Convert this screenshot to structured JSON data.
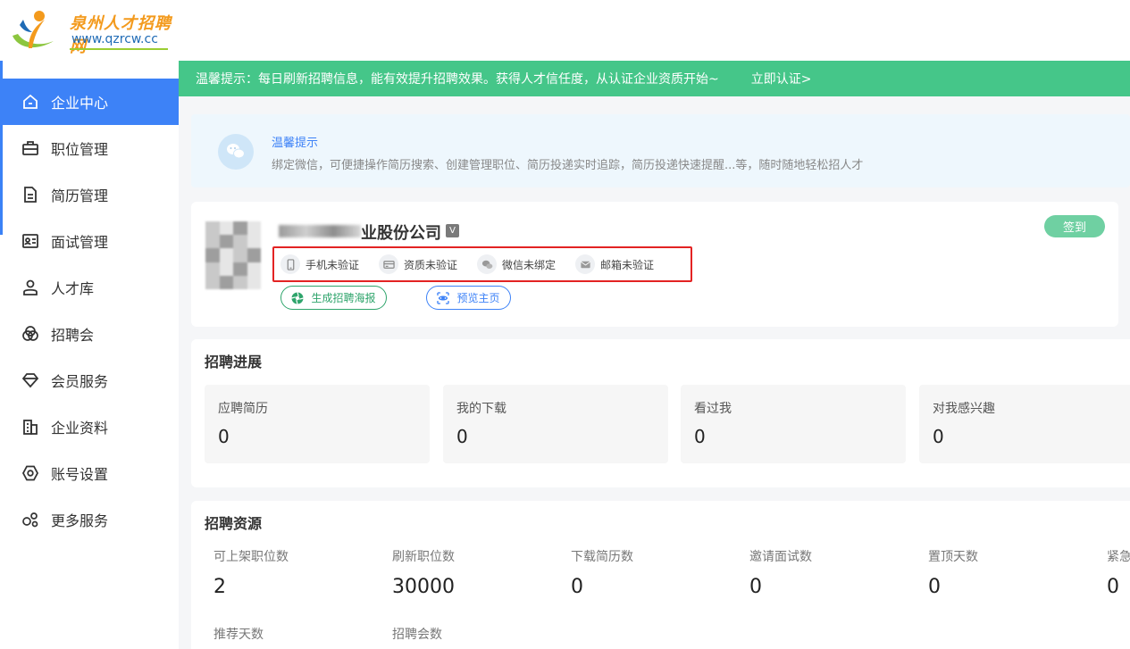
{
  "logo": {
    "title": "泉州人才招聘网",
    "url": "www.qzrcw.cc"
  },
  "sidebar": {
    "items": [
      {
        "label": "企业中心",
        "icon": "home-icon",
        "active": true
      },
      {
        "label": "职位管理",
        "icon": "briefcase-icon",
        "active": false
      },
      {
        "label": "简历管理",
        "icon": "document-icon",
        "active": false
      },
      {
        "label": "面试管理",
        "icon": "id-card-icon",
        "active": false
      },
      {
        "label": "人才库",
        "icon": "person-icon",
        "active": false
      },
      {
        "label": "招聘会",
        "icon": "venn-icon",
        "active": false
      },
      {
        "label": "会员服务",
        "icon": "diamond-icon",
        "active": false
      },
      {
        "label": "企业资料",
        "icon": "building-icon",
        "active": false
      },
      {
        "label": "账号设置",
        "icon": "settings-icon",
        "active": false
      },
      {
        "label": "更多服务",
        "icon": "more-services-icon",
        "active": false
      }
    ]
  },
  "banner": {
    "text": "温馨提示：每日刷新招聘信息，能有效提升招聘效果。获得人才信任度，从认证企业资质开始~",
    "link": "立即认证>"
  },
  "tip": {
    "title": "温馨提示",
    "text": "绑定微信，可便捷操作简历搜索、创建管理职位、简历投递实时追踪，简历投递快速提醒...等，随时随地轻松招人才"
  },
  "company": {
    "name_visible": "业股份公司",
    "verify_badge": "V",
    "verifications": [
      {
        "label": "手机未验证",
        "icon": "phone-icon"
      },
      {
        "label": "资质未验证",
        "icon": "license-icon"
      },
      {
        "label": "微信未绑定",
        "icon": "wechat-icon"
      },
      {
        "label": "邮箱未验证",
        "icon": "mail-icon"
      }
    ],
    "poster_button": "生成招聘海报",
    "preview_button": "预览主页",
    "sign_button": "签到"
  },
  "progress": {
    "title": "招聘进展",
    "cards": [
      {
        "label": "应聘简历",
        "value": "0"
      },
      {
        "label": "我的下载",
        "value": "0"
      },
      {
        "label": "看过我",
        "value": "0"
      },
      {
        "label": "对我感兴趣",
        "value": "0"
      }
    ]
  },
  "resources": {
    "title": "招聘资源",
    "items": [
      {
        "label": "可上架职位数",
        "value": "2"
      },
      {
        "label": "刷新职位数",
        "value": "30000"
      },
      {
        "label": "下载简历数",
        "value": "0"
      },
      {
        "label": "邀请面试数",
        "value": "0"
      },
      {
        "label": "置顶天数",
        "value": "0"
      },
      {
        "label": "紧急",
        "value": "0"
      },
      {
        "label": "推荐天数",
        "value": ""
      },
      {
        "label": "招聘会数",
        "value": ""
      }
    ]
  },
  "colors": {
    "accent": "#3d82f7",
    "banner_green": "#45c689",
    "alert_red": "#e32323"
  }
}
